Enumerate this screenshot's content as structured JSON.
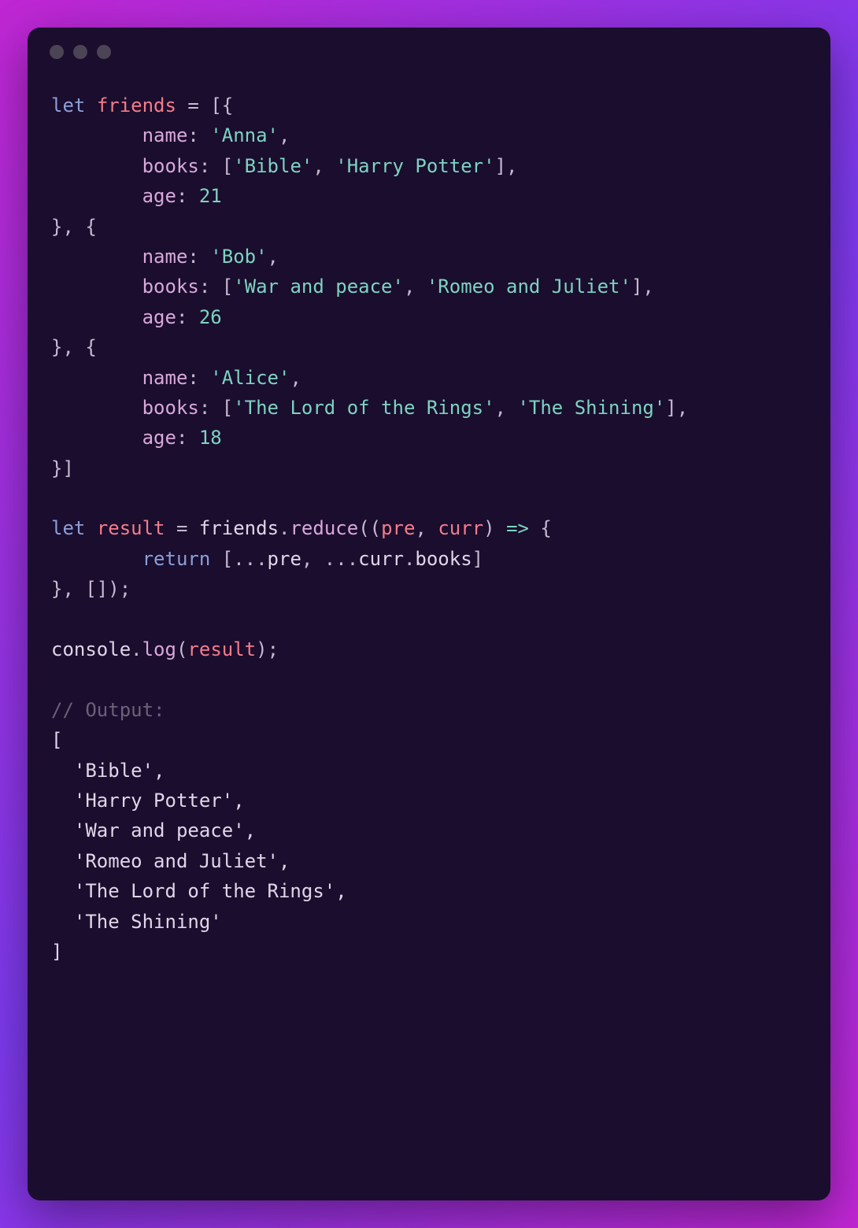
{
  "tokens": [
    {
      "cls": "tok-keyword",
      "text": "let"
    },
    {
      "cls": "",
      "text": " "
    },
    {
      "cls": "tok-variable",
      "text": "friends"
    },
    {
      "cls": "",
      "text": " "
    },
    {
      "cls": "tok-punct",
      "text": "="
    },
    {
      "cls": "",
      "text": " "
    },
    {
      "cls": "tok-punct",
      "text": "[{"
    },
    {
      "cls": "",
      "text": "\n        "
    },
    {
      "cls": "tok-property",
      "text": "name"
    },
    {
      "cls": "tok-punct",
      "text": ":"
    },
    {
      "cls": "",
      "text": " "
    },
    {
      "cls": "tok-string",
      "text": "'Anna'"
    },
    {
      "cls": "tok-punct",
      "text": ","
    },
    {
      "cls": "",
      "text": "\n        "
    },
    {
      "cls": "tok-property",
      "text": "books"
    },
    {
      "cls": "tok-punct",
      "text": ":"
    },
    {
      "cls": "",
      "text": " "
    },
    {
      "cls": "tok-punct",
      "text": "["
    },
    {
      "cls": "tok-string",
      "text": "'Bible'"
    },
    {
      "cls": "tok-punct",
      "text": ","
    },
    {
      "cls": "",
      "text": " "
    },
    {
      "cls": "tok-string",
      "text": "'Harry Potter'"
    },
    {
      "cls": "tok-punct",
      "text": "],"
    },
    {
      "cls": "",
      "text": "\n        "
    },
    {
      "cls": "tok-property",
      "text": "age"
    },
    {
      "cls": "tok-punct",
      "text": ":"
    },
    {
      "cls": "",
      "text": " "
    },
    {
      "cls": "tok-number",
      "text": "21"
    },
    {
      "cls": "",
      "text": "\n"
    },
    {
      "cls": "tok-punct",
      "text": "}, {"
    },
    {
      "cls": "",
      "text": "\n        "
    },
    {
      "cls": "tok-property",
      "text": "name"
    },
    {
      "cls": "tok-punct",
      "text": ":"
    },
    {
      "cls": "",
      "text": " "
    },
    {
      "cls": "tok-string",
      "text": "'Bob'"
    },
    {
      "cls": "tok-punct",
      "text": ","
    },
    {
      "cls": "",
      "text": "\n        "
    },
    {
      "cls": "tok-property",
      "text": "books"
    },
    {
      "cls": "tok-punct",
      "text": ":"
    },
    {
      "cls": "",
      "text": " "
    },
    {
      "cls": "tok-punct",
      "text": "["
    },
    {
      "cls": "tok-string",
      "text": "'War and peace'"
    },
    {
      "cls": "tok-punct",
      "text": ","
    },
    {
      "cls": "",
      "text": " "
    },
    {
      "cls": "tok-string",
      "text": "'Romeo and Juliet'"
    },
    {
      "cls": "tok-punct",
      "text": "],"
    },
    {
      "cls": "",
      "text": "\n        "
    },
    {
      "cls": "tok-property",
      "text": "age"
    },
    {
      "cls": "tok-punct",
      "text": ":"
    },
    {
      "cls": "",
      "text": " "
    },
    {
      "cls": "tok-number",
      "text": "26"
    },
    {
      "cls": "",
      "text": "\n"
    },
    {
      "cls": "tok-punct",
      "text": "}, {"
    },
    {
      "cls": "",
      "text": "\n        "
    },
    {
      "cls": "tok-property",
      "text": "name"
    },
    {
      "cls": "tok-punct",
      "text": ":"
    },
    {
      "cls": "",
      "text": " "
    },
    {
      "cls": "tok-string",
      "text": "'Alice'"
    },
    {
      "cls": "tok-punct",
      "text": ","
    },
    {
      "cls": "",
      "text": "\n        "
    },
    {
      "cls": "tok-property",
      "text": "books"
    },
    {
      "cls": "tok-punct",
      "text": ":"
    },
    {
      "cls": "",
      "text": " "
    },
    {
      "cls": "tok-punct",
      "text": "["
    },
    {
      "cls": "tok-string",
      "text": "'The Lord of the Rings'"
    },
    {
      "cls": "tok-punct",
      "text": ","
    },
    {
      "cls": "",
      "text": " "
    },
    {
      "cls": "tok-string",
      "text": "'The Shining'"
    },
    {
      "cls": "tok-punct",
      "text": "],"
    },
    {
      "cls": "",
      "text": "\n        "
    },
    {
      "cls": "tok-property",
      "text": "age"
    },
    {
      "cls": "tok-punct",
      "text": ":"
    },
    {
      "cls": "",
      "text": " "
    },
    {
      "cls": "tok-number",
      "text": "18"
    },
    {
      "cls": "",
      "text": "\n"
    },
    {
      "cls": "tok-punct",
      "text": "}]"
    },
    {
      "cls": "",
      "text": "\n\n"
    },
    {
      "cls": "tok-keyword",
      "text": "let"
    },
    {
      "cls": "",
      "text": " "
    },
    {
      "cls": "tok-variable",
      "text": "result"
    },
    {
      "cls": "",
      "text": " "
    },
    {
      "cls": "tok-punct",
      "text": "="
    },
    {
      "cls": "",
      "text": " "
    },
    {
      "cls": "tok-output",
      "text": "friends"
    },
    {
      "cls": "tok-punct",
      "text": "."
    },
    {
      "cls": "tok-method",
      "text": "reduce"
    },
    {
      "cls": "tok-punct",
      "text": "(("
    },
    {
      "cls": "tok-param",
      "text": "pre"
    },
    {
      "cls": "tok-punct",
      "text": ","
    },
    {
      "cls": "",
      "text": " "
    },
    {
      "cls": "tok-param",
      "text": "curr"
    },
    {
      "cls": "tok-punct",
      "text": ")"
    },
    {
      "cls": "",
      "text": " "
    },
    {
      "cls": "tok-arrow",
      "text": "=>"
    },
    {
      "cls": "",
      "text": " "
    },
    {
      "cls": "tok-punct",
      "text": "{"
    },
    {
      "cls": "",
      "text": "\n        "
    },
    {
      "cls": "tok-keyword",
      "text": "return"
    },
    {
      "cls": "",
      "text": " "
    },
    {
      "cls": "tok-punct",
      "text": "[..."
    },
    {
      "cls": "tok-output",
      "text": "pre"
    },
    {
      "cls": "tok-punct",
      "text": ", ..."
    },
    {
      "cls": "tok-output",
      "text": "curr"
    },
    {
      "cls": "tok-punct",
      "text": "."
    },
    {
      "cls": "tok-output",
      "text": "books"
    },
    {
      "cls": "tok-punct",
      "text": "]"
    },
    {
      "cls": "",
      "text": "\n"
    },
    {
      "cls": "tok-punct",
      "text": "}, []);"
    },
    {
      "cls": "",
      "text": "\n\n"
    },
    {
      "cls": "tok-output",
      "text": "console"
    },
    {
      "cls": "tok-punct",
      "text": "."
    },
    {
      "cls": "tok-method",
      "text": "log"
    },
    {
      "cls": "tok-punct",
      "text": "("
    },
    {
      "cls": "tok-variable",
      "text": "result"
    },
    {
      "cls": "tok-punct",
      "text": ");"
    },
    {
      "cls": "",
      "text": "\n\n"
    },
    {
      "cls": "tok-comment",
      "text": "// Output:"
    },
    {
      "cls": "",
      "text": "\n"
    },
    {
      "cls": "tok-output",
      "text": "[\n  'Bible',\n  'Harry Potter',\n  'War and peace',\n  'Romeo and Juliet',\n  'The Lord of the Rings',\n  'The Shining'\n]"
    }
  ]
}
